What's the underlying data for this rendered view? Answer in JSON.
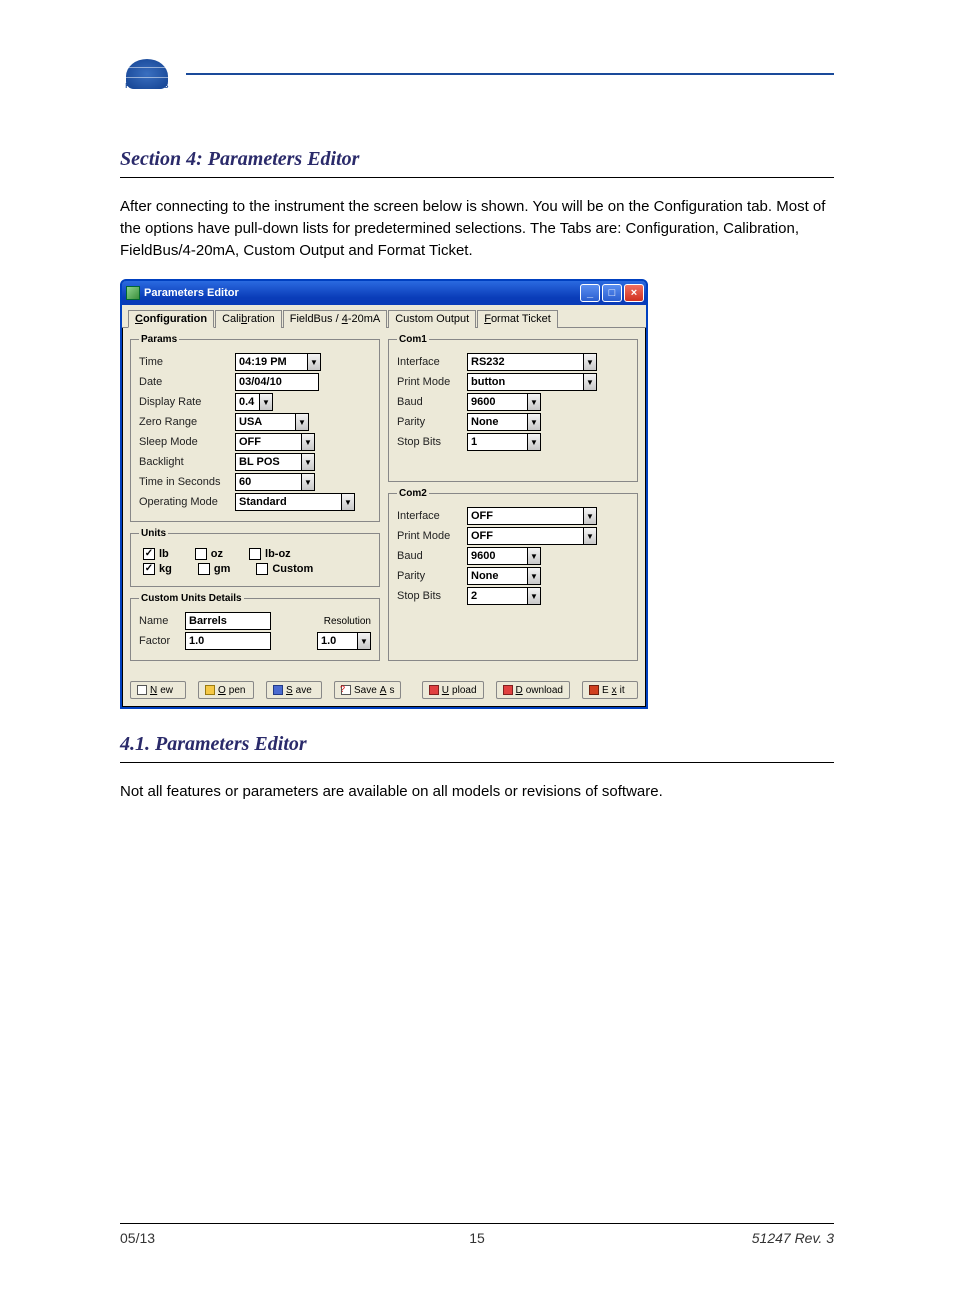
{
  "page_header": {
    "logo_text": "FAIRBANKS"
  },
  "section_title": "Section 4:  Parameters Editor",
  "intro_text": "After connecting to the instrument the screen below is shown. You will be on the Configuration tab. Most of the options have pull-down lists for predetermined selections. The Tabs are: Configuration, Calibration, FieldBus/4-20mA, Custom Output and Format Ticket.",
  "window": {
    "title": "Parameters Editor",
    "tabs": [
      {
        "label": "Configuration",
        "underline": "C",
        "active": true
      },
      {
        "label": "Calibration",
        "underline": "b",
        "active": false
      },
      {
        "label": "FieldBus / 4-20mA",
        "underline": "4",
        "active": false
      },
      {
        "label": "Custom Output",
        "underline": "",
        "active": false
      },
      {
        "label": "Format Ticket",
        "underline": "F",
        "active": false
      }
    ],
    "params": {
      "legend": "Params",
      "time_label": "Time",
      "time_value": "04:19 PM",
      "date_label": "Date",
      "date_value": "03/04/10",
      "display_rate_label": "Display Rate",
      "display_rate_value": "0.4",
      "zero_range_label": "Zero Range",
      "zero_range_value": "USA",
      "sleep_mode_label": "Sleep Mode",
      "sleep_mode_value": "OFF",
      "backlight_label": "Backlight",
      "backlight_value": "BL POS",
      "time_seconds_label": "Time in Seconds",
      "time_seconds_value": "60",
      "operating_mode_label": "Operating Mode",
      "operating_mode_value": "Standard"
    },
    "units": {
      "legend": "Units",
      "lb": {
        "label": "lb",
        "checked": true
      },
      "oz": {
        "label": "oz",
        "checked": false
      },
      "lboz": {
        "label": "lb-oz",
        "checked": false
      },
      "kg": {
        "label": "kg",
        "checked": true
      },
      "gm": {
        "label": "gm",
        "checked": false
      },
      "custom": {
        "label": "Custom",
        "checked": false
      }
    },
    "custom_units": {
      "legend": "Custom Units Details",
      "name_label": "Name",
      "name_value": "Barrels",
      "factor_label": "Factor",
      "factor_value": "1.0",
      "resolution_label": "Resolution",
      "resolution_value": "1.0"
    },
    "com1": {
      "legend": "Com1",
      "interface_label": "Interface",
      "interface_value": "RS232",
      "print_mode_label": "Print Mode",
      "print_mode_value": "button",
      "baud_label": "Baud",
      "baud_value": "9600",
      "parity_label": "Parity",
      "parity_value": "None",
      "stop_bits_label": "Stop Bits",
      "stop_bits_value": "1"
    },
    "com2": {
      "legend": "Com2",
      "interface_label": "Interface",
      "interface_value": "OFF",
      "print_mode_label": "Print Mode",
      "print_mode_value": "OFF",
      "baud_label": "Baud",
      "baud_value": "9600",
      "parity_label": "Parity",
      "parity_value": "None",
      "stop_bits_label": "Stop Bits",
      "stop_bits_value": "2"
    },
    "buttons": {
      "new": "New",
      "open": "Open",
      "save": "Save",
      "save_as": "Save As",
      "upload": "Upload",
      "download": "Download",
      "exit": "Exit"
    }
  },
  "subsection_title": "4.1. Parameters Editor",
  "note_text": "Not all features or parameters are available on all models or revisions of software.",
  "footer": {
    "left": "05/13",
    "center": "15",
    "right": "51247 Rev. 3"
  }
}
